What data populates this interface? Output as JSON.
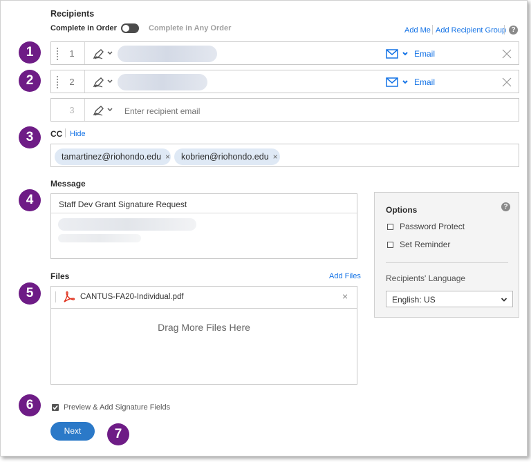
{
  "recipients": {
    "title": "Recipients",
    "complete_in_order": "Complete in Order",
    "complete_any_order": "Complete in Any Order",
    "add_me": "Add Me",
    "add_group": "Add Recipient Group",
    "help": "?",
    "rows": [
      {
        "num": "1",
        "method": "Email"
      },
      {
        "num": "2",
        "method": "Email"
      },
      {
        "num": "3",
        "placeholder": "Enter recipient email"
      }
    ]
  },
  "cc": {
    "label": "CC",
    "hide": "Hide",
    "chips": [
      "tamartinez@riohondo.edu",
      "kobrien@riohondo.edu"
    ],
    "remove": "×"
  },
  "message": {
    "label": "Message",
    "subject": "Staff Dev Grant Signature Request"
  },
  "options": {
    "title": "Options",
    "help": "?",
    "password_protect": "Password Protect",
    "set_reminder": "Set Reminder",
    "language_label": "Recipients' Language",
    "language_value": "English: US"
  },
  "files": {
    "label": "Files",
    "add_files": "Add Files",
    "file_name": "CANTUS-FA20-Individual.pdf",
    "remove": "×",
    "drag_text": "Drag More Files Here"
  },
  "preview": {
    "label": "Preview & Add Signature Fields",
    "checked": true
  },
  "next_button": "Next",
  "badges": [
    "1",
    "2",
    "3",
    "4",
    "5",
    "6",
    "7"
  ],
  "colors": {
    "badge": "#6e1c86",
    "accent": "#1473e6",
    "next_button": "#2b79c8"
  }
}
